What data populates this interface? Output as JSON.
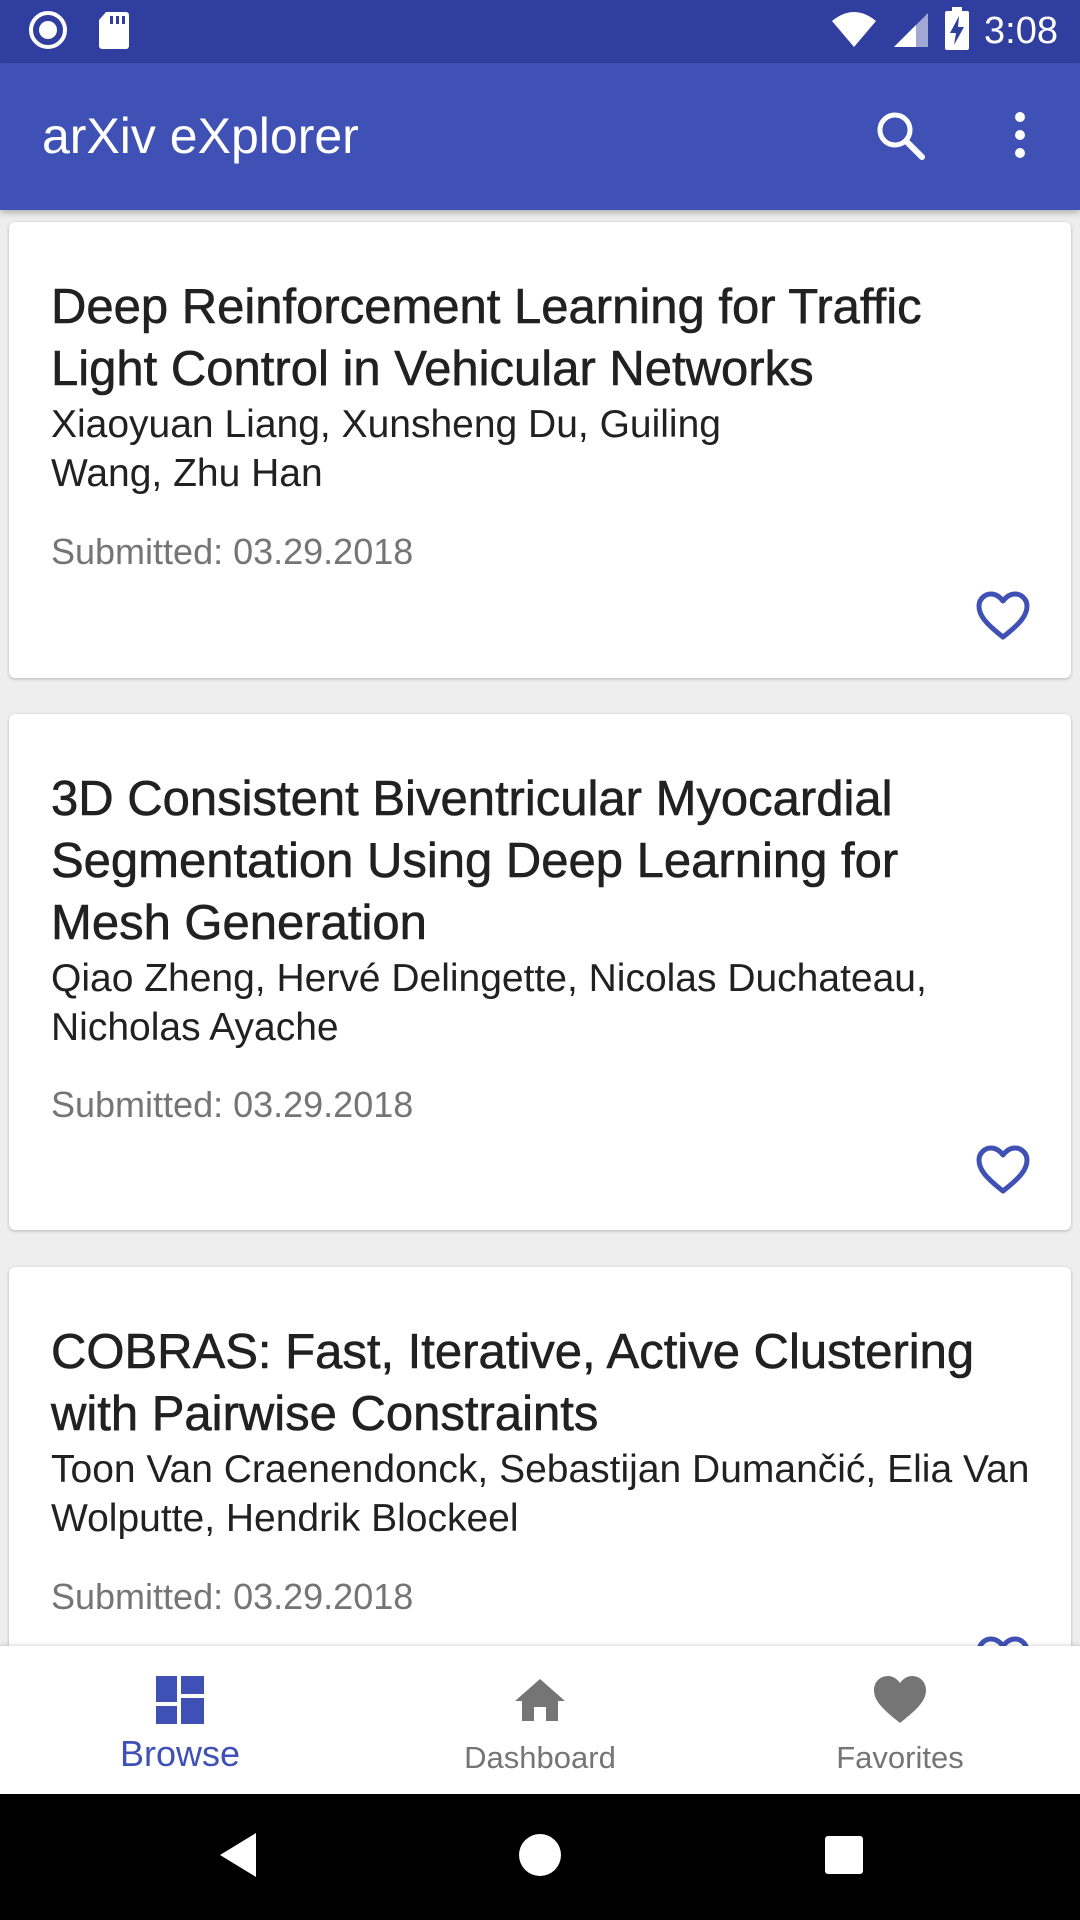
{
  "status_bar": {
    "time": "3:08",
    "left_icons": [
      "circle-notification-icon",
      "sd-card-icon"
    ],
    "right_icons": [
      "wifi-icon",
      "signal-icon",
      "battery-charging-icon"
    ]
  },
  "app_bar": {
    "title": "arXiv eXplorer",
    "actions": [
      "search-icon",
      "more-vert-icon"
    ],
    "color": "#3f51b5",
    "status_color": "#303f9f"
  },
  "papers": [
    {
      "title": "Deep Reinforcement Learning for Traffic Light Control in Vehicular Networks",
      "authors": "Xiaoyuan Liang, Xunsheng Du, Guiling Wang, Zhu Han",
      "submitted": "Submitted: 03.29.2018",
      "favorite": false
    },
    {
      "title": "3D Consistent Biventricular Myocardial Segmentation Using Deep Learning for Mesh Generation",
      "authors": "Qiao Zheng, Hervé Delingette, Nicolas Duchateau, Nicholas Ayache",
      "submitted": "Submitted: 03.29.2018",
      "favorite": false
    },
    {
      "title": "COBRAS: Fast, Iterative, Active Clustering with Pairwise Constraints",
      "authors": "Toon Van Craenendonck, Sebastijan Dumančić, Elia Van Wolputte, Hendrik Blockeel",
      "submitted": "Submitted: 03.29.2018",
      "favorite": false
    }
  ],
  "bottom_nav": {
    "items": [
      {
        "label": "Browse",
        "icon": "dashboard-grid-icon",
        "active": true
      },
      {
        "label": "Dashboard",
        "icon": "home-icon",
        "active": false
      },
      {
        "label": "Favorites",
        "icon": "heart-filled-icon",
        "active": false
      }
    ],
    "active_color": "#3f51b5",
    "inactive_color": "#757575"
  },
  "system_nav": [
    "back-icon",
    "home-circle-icon",
    "recents-icon"
  ]
}
